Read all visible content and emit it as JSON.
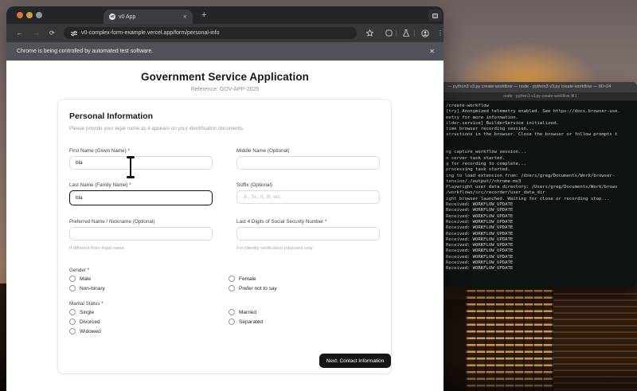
{
  "browser": {
    "tab_title": "v0 App",
    "favicon_text": "v0",
    "url": "v0-complex-form-example.vercel.app/form/personal-info",
    "infobar_text": "Chrome is being controlled by automated test software."
  },
  "icons": {
    "close": "✕",
    "plus": "+",
    "back": "←",
    "forward": "→",
    "reload": "⟳",
    "kebab": "⋮"
  },
  "page": {
    "title": "Government Service Application",
    "reference": "Reference: GOV-APP-2025",
    "section_heading": "Personal Information",
    "section_subtitle": "Please provide your legal name as it appears on your identification documents.",
    "fields": [
      {
        "label": "First Name (Given Name) *",
        "value": "bla"
      },
      {
        "label": "Middle Name (Optional)",
        "value": ""
      },
      {
        "label": "Last Name (Family Name) *",
        "value": "bla"
      },
      {
        "label": "Suffix (Optional)",
        "placeholder": "Jr., Sr., II, III, etc."
      },
      {
        "label": "Preferred Name / Nickname (Optional)",
        "helper": "If different from legal name"
      },
      {
        "label": "Last 4 Digits of Social Security Number *",
        "helper": "For identity verification purposes only"
      }
    ],
    "gender": {
      "label": "Gender *",
      "col1": [
        "Male",
        "Non-binary"
      ],
      "col2": [
        "Female",
        "Prefer not to say"
      ]
    },
    "marital": {
      "label": "Marital Status *",
      "col1": [
        "Single",
        "Divorced",
        "Widowed"
      ],
      "col2": [
        "Married",
        "Separated"
      ]
    },
    "next_button": "Next: Contact Information"
  },
  "terminal": {
    "title": "— python3 v3.py create-workflow — node · python3 v3.py create-workflow — 80×24",
    "tab": "node · python3 v3.py create-workflow  ⌘1",
    "lines": [
      "/create-workflow",
      "[try] Anonymized telemetry enabled. See https://docs.browser-use.",
      "metry for more information.",
      "ilder.service] BuilderService initialized.",
      "time browser recording session...",
      "structions in the browser. Close the browser or follow prompts t",
      "",
      "",
      "ng capture_workflow session...",
      "n server task started.",
      "g for recording to complete...",
      "processing task started.",
      "ing to load extension from: /Users/greg/Documents/Work/browser-",
      "tension/./output//chrome-mv3",
      "Playwright user data directory: /Users/greg/Documents/Work/brows",
      "/workflows/src/recorder/user_data_dir",
      "ight browser launched. Waiting for close or recording stop...",
      "Received: WORKFLOW_UPDATE",
      "Received: WORKFLOW_UPDATE",
      "Received: WORKFLOW_UPDATE",
      "Received: WORKFLOW_UPDATE",
      "Received: WORKFLOW_UPDATE",
      "Received: WORKFLOW_UPDATE",
      "Received: WORKFLOW_UPDATE",
      "Received: WORKFLOW_UPDATE",
      "Received: WORKFLOW_UPDATE",
      "Received: WORKFLOW_UPDATE",
      "Received: WORKFLOW_UPDATE",
      "Received: WORKFLOW_UPDATE"
    ]
  },
  "colors": {
    "button_bg": "#151517",
    "focus_ring": "#0f0f10",
    "terminal_bg": "#0d1312",
    "infobar_bg": "#50525a",
    "sunset_glow": "#eea23e"
  }
}
